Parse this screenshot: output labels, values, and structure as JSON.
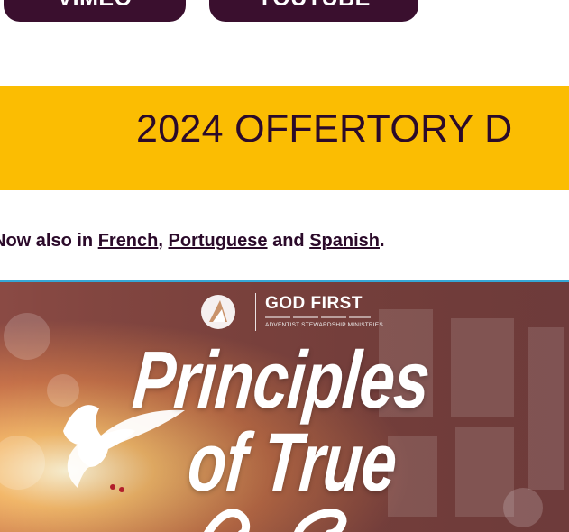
{
  "buttons": {
    "vimeo": "VIMEO",
    "youtube": "YOUTUBE"
  },
  "banner": {
    "title": "2024 OFFERTORY D"
  },
  "languages": {
    "prefix": "Now also in ",
    "french": "French",
    "sep1": ",",
    "portuguese": "Portuguese",
    "and": " and ",
    "spanish": "Spanish",
    "end": "."
  },
  "hero": {
    "logo_title": "GOD FIRST",
    "logo_subtitle": "ADVENTIST STEWARDSHIP MINISTRIES",
    "title_line1": "Principles",
    "title_line2": "of True"
  },
  "colors": {
    "button_bg": "#3a0f2e",
    "banner_bg": "#fbbd02",
    "text_dark": "#2b0a2a",
    "hero_border": "#35a7d6"
  },
  "icons": [
    "church-logo-icon",
    "dove-illustration"
  ]
}
